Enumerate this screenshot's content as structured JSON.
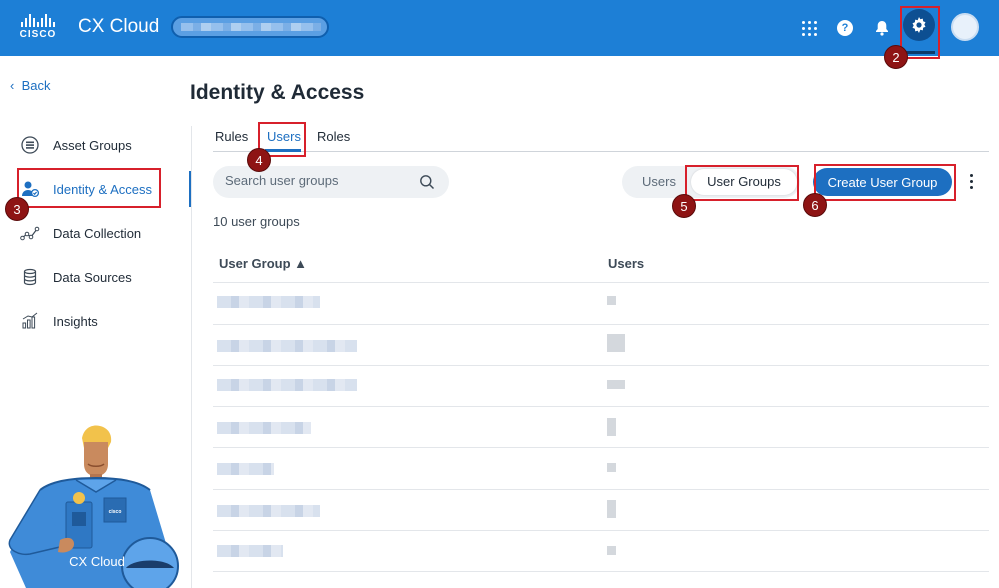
{
  "header": {
    "logo_text": "CISCO",
    "app_title": "CX Cloud",
    "icons": [
      "apps-grid-icon",
      "help-icon",
      "bell-icon",
      "gear-icon",
      "avatar"
    ]
  },
  "sidebar": {
    "back_label": "Back",
    "items": [
      {
        "label": "Asset Groups",
        "icon": "asset-groups-icon"
      },
      {
        "label": "Identity & Access",
        "icon": "identity-icon",
        "active": true
      },
      {
        "label": "Data Collection",
        "icon": "data-collection-icon"
      },
      {
        "label": "Data Sources",
        "icon": "database-icon"
      },
      {
        "label": "Insights",
        "icon": "insights-icon"
      }
    ]
  },
  "main": {
    "title": "Identity & Access",
    "tabs": [
      {
        "label": "Rules"
      },
      {
        "label": "Users",
        "active": true
      },
      {
        "label": "Roles"
      }
    ],
    "search": {
      "placeholder": "Search user groups"
    },
    "toggle": {
      "users_label": "Users",
      "groups_label": "User Groups",
      "selected": "User Groups"
    },
    "create_label": "Create User Group",
    "count_text": "10 user groups",
    "table": {
      "columns": [
        "User Group ▲",
        "Users"
      ]
    }
  },
  "callouts": [
    "2",
    "3",
    "4",
    "5",
    "6"
  ],
  "mascot": {
    "label": "CX Cloud",
    "badge_text": "cisco"
  },
  "colors": {
    "header": "#1d7fd6",
    "accent": "#1d6fc1",
    "callout": "#d7202b",
    "badge": "#8e1414"
  }
}
